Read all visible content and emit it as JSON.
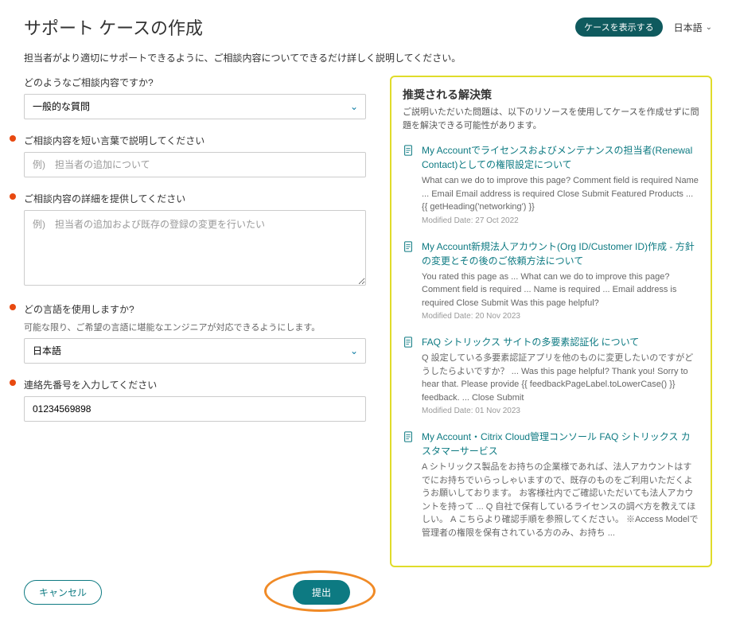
{
  "header": {
    "title": "サポート ケースの作成",
    "view_cases": "ケースを表示する",
    "language": "日本語"
  },
  "intro": "担当者がより適切にサポートできるように、ご相談内容についてできるだけ詳しく説明してください。",
  "form": {
    "type_label": "どのようなご相談内容ですか?",
    "type_value": "一般的な質問",
    "subject_label": "ご相談内容を短い言葉で説明してください",
    "subject_placeholder": "例)　担当者の追加について",
    "detail_label": "ご相談内容の詳細を提供してください",
    "detail_placeholder": "例)　担当者の追加および既存の登録の変更を行いたい",
    "lang_label": "どの言語を使用しますか?",
    "lang_help": "可能な限り、ご希望の言語に堪能なエンジニアが対応できるようにします。",
    "lang_value": "日本語",
    "phone_label": "連絡先番号を入力してください",
    "phone_value": "01234569898"
  },
  "recommend": {
    "title": "推奨される解決策",
    "intro": "ご説明いただいた問題は、以下のリソースを使用してケースを作成せずに問題を解決できる可能性があります。",
    "items": [
      {
        "title": "My Accountでライセンスおよびメンテナンスの担当者(Renewal Contact)としての権限設定について",
        "desc": "What can we do to improve this page? Comment field is required Name ... Email Email address is required Close Submit Featured Products ... {{ getHeading('networking') }}",
        "date": "Modified Date: 27 Oct 2022"
      },
      {
        "title": "My Account新規法人アカウント(Org ID/Customer ID)作成 - 方針の変更とその後のご依頼方法について",
        "desc": "You rated this page as ... What can we do to improve this page? Comment field is required ... Name is required ... Email address is required Close Submit Was this page helpful?",
        "date": "Modified Date: 20 Nov 2023"
      },
      {
        "title": "FAQ シトリックス サイトの多要素認証化 について",
        "desc": "Q 設定している多要素認証アプリを他のものに変更したいのですがどうしたらよいですか？ ... Was this page helpful? Thank you! Sorry to hear that. Please provide {{ feedbackPageLabel.toLowerCase() }} feedback. ... Close Submit",
        "date": "Modified Date: 01 Nov 2023"
      },
      {
        "title": "My Account・Citrix Cloud管理コンソール FAQ シトリックス カスタマーサービス",
        "desc": "A シトリックス製品をお持ちの企業様であれば、法人アカウントはすでにお持ちでいらっしゃいますので、既存のものをご利用いただくようお願いしております。 お客様社内でご確認いただいても法人アカウントを持って ... Q 自社で保有しているライセンスの調べ方を教えてほしい。 A こちらより確認手順を参照してください。 ※Access Modelで管理者の権限を保有されている方のみ、お持ち ...",
        "date": ""
      }
    ]
  },
  "footer": {
    "cancel": "キャンセル",
    "submit": "提出"
  }
}
